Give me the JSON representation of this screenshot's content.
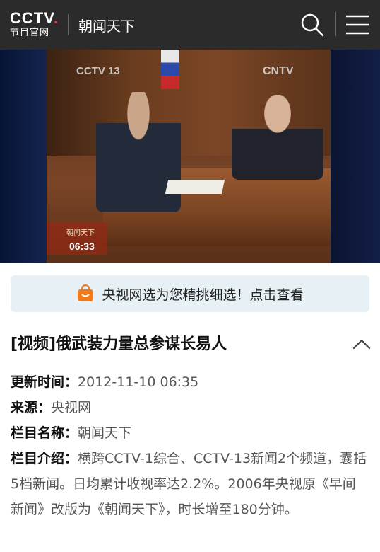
{
  "header": {
    "logo_brand": "CCTV",
    "logo_sub": "节目官网",
    "program_name": "朝闻天下"
  },
  "video": {
    "watermark_left": "CCTV 13",
    "watermark_right": "CNTV",
    "lower_third_title": "朝闻天下",
    "lower_third_time": "06:33"
  },
  "banner": {
    "text": "央视网选为您精挑细选！点击查看",
    "accent": "#f07a1a"
  },
  "article": {
    "title": "[视频]俄武装力量总参谋长易人",
    "update_label": "更新时间：",
    "update_value": "2012-11-10 06:35",
    "source_label": "来源：",
    "source_value": "央视网",
    "column_label": "栏目名称：",
    "column_value": "朝闻天下",
    "intro_label": "栏目介绍：",
    "intro_value": "横跨CCTV-1综合、CCTV-13新闻2个频道，囊括5档新闻。日均累计收视率达2.2%。2006年央视原《早间新闻》改版为《朝闻天下》，时长增至180分钟。"
  },
  "colors": {
    "topbar": "#2b2b2b",
    "banner_bg": "#e7f0f5",
    "play_badge": "#e8412f"
  }
}
